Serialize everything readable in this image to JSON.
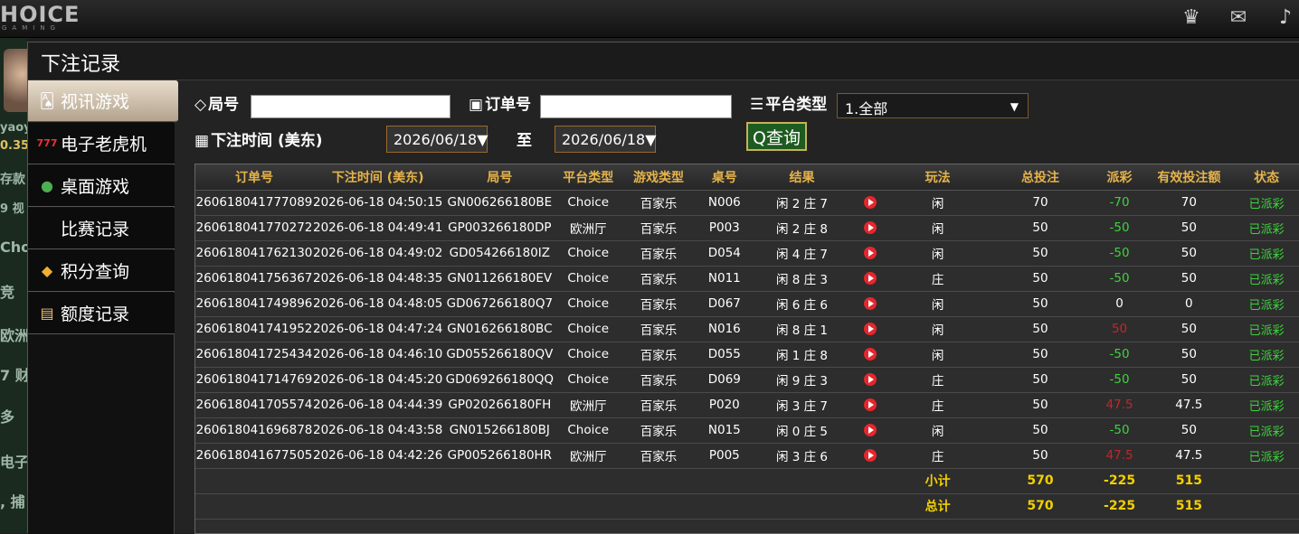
{
  "app": {
    "logo": "HOICE",
    "logo_sub": "GAMING"
  },
  "header_icons": [
    "vip-icon",
    "chat-icon",
    "music-icon"
  ],
  "background": {
    "fragments": [
      "yaoy",
      "0.35",
      "存款",
      "9 视",
      "Cho",
      "竞",
      "欧洲",
      "7 财",
      "多",
      "电子",
      ", 捕"
    ]
  },
  "modal": {
    "title": "下注记录"
  },
  "sidebar": {
    "items": [
      {
        "label": "视讯游戏",
        "icon": "cards-icon",
        "active": true
      },
      {
        "label": "电子老虎机",
        "icon": "slot-777-icon"
      },
      {
        "label": "桌面游戏",
        "icon": "chips-icon"
      },
      {
        "label": "比赛记录",
        "icon": ""
      },
      {
        "label": "积分查询",
        "icon": "diamond-icon"
      },
      {
        "label": "额度记录",
        "icon": "document-icon"
      }
    ]
  },
  "filters": {
    "round_label": "局号",
    "round_value": "",
    "order_label": "订单号",
    "order_value": "",
    "platform_label": "平台类型",
    "platform_value": "1.全部",
    "time_label": "下注时间 (美东)",
    "date_from": "2026/06/18",
    "to_label": "至",
    "date_to": "2026/06/18",
    "query_label": "查询",
    "dropdown_arrow": "▼"
  },
  "table": {
    "headers": [
      "订单号",
      "下注时间 (美东)",
      "局号",
      "平台类型",
      "游戏类型",
      "桌号",
      "结果",
      "",
      "玩法",
      "总投注",
      "派彩",
      "有效投注额",
      "状态"
    ],
    "rows": [
      [
        "260618041777089",
        "2026-06-18 04:50:15",
        "GN006266180BE",
        "Choice",
        "百家乐",
        "N006",
        "闲 2 庄 7",
        "闲",
        "70",
        "-70",
        "70",
        "已派彩"
      ],
      [
        "260618041770272",
        "2026-06-18 04:49:41",
        "GP003266180DP",
        "欧洲厅",
        "百家乐",
        "P003",
        "闲 2 庄 8",
        "闲",
        "50",
        "-50",
        "50",
        "已派彩"
      ],
      [
        "260618041762130",
        "2026-06-18 04:49:02",
        "GD054266180IZ",
        "Choice",
        "百家乐",
        "D054",
        "闲 4 庄 7",
        "闲",
        "50",
        "-50",
        "50",
        "已派彩"
      ],
      [
        "260618041756367",
        "2026-06-18 04:48:35",
        "GN011266180EV",
        "Choice",
        "百家乐",
        "N011",
        "闲 8 庄 3",
        "庄",
        "50",
        "-50",
        "50",
        "已派彩"
      ],
      [
        "260618041749896",
        "2026-06-18 04:48:05",
        "GD067266180Q7",
        "Choice",
        "百家乐",
        "D067",
        "闲 6 庄 6",
        "闲",
        "50",
        "0",
        "0",
        "已派彩"
      ],
      [
        "260618041741952",
        "2026-06-18 04:47:24",
        "GN016266180BC",
        "Choice",
        "百家乐",
        "N016",
        "闲 8 庄 1",
        "闲",
        "50",
        "50",
        "50",
        "已派彩"
      ],
      [
        "260618041725434",
        "2026-06-18 04:46:10",
        "GD055266180QV",
        "Choice",
        "百家乐",
        "D055",
        "闲 1 庄 8",
        "闲",
        "50",
        "-50",
        "50",
        "已派彩"
      ],
      [
        "260618041714769",
        "2026-06-18 04:45:20",
        "GD069266180QQ",
        "Choice",
        "百家乐",
        "D069",
        "闲 9 庄 3",
        "庄",
        "50",
        "-50",
        "50",
        "已派彩"
      ],
      [
        "260618041705574",
        "2026-06-18 04:44:39",
        "GP020266180FH",
        "欧洲厅",
        "百家乐",
        "P020",
        "闲 3 庄 7",
        "庄",
        "50",
        "47.5",
        "47.5",
        "已派彩"
      ],
      [
        "260618041696878",
        "2026-06-18 04:43:58",
        "GN015266180BJ",
        "Choice",
        "百家乐",
        "N015",
        "闲 0 庄 5",
        "闲",
        "50",
        "-50",
        "50",
        "已派彩"
      ],
      [
        "260618041677505",
        "2026-06-18 04:42:26",
        "GP005266180HR",
        "欧洲厅",
        "百家乐",
        "P005",
        "闲 3 庄 6",
        "庄",
        "50",
        "47.5",
        "47.5",
        "已派彩"
      ]
    ],
    "subtotal": {
      "label": "小计",
      "total_bet": "570",
      "payout": "-225",
      "valid_bet": "515"
    },
    "total": {
      "label": "总计",
      "total_bet": "570",
      "payout": "-225",
      "valid_bet": "515"
    }
  },
  "colors": {
    "positive": "#3ed33e",
    "negative_win": "#c1272d",
    "accent_header": "#e6b34a",
    "sum_yellow": "#f3d000"
  }
}
